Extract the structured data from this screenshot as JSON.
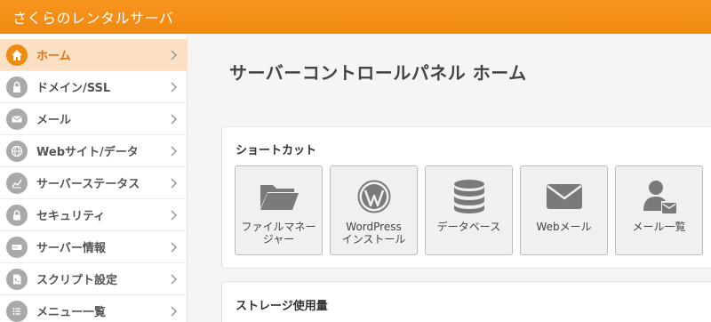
{
  "header": {
    "brand": "さくらのレンタルサーバ"
  },
  "sidebar": {
    "items": [
      {
        "label": "ホーム",
        "icon": "home-icon",
        "active": true
      },
      {
        "label": "ドメイン/SSL",
        "icon": "lock-icon",
        "active": false
      },
      {
        "label": "メール",
        "icon": "mail-icon",
        "active": false
      },
      {
        "label": "Webサイト/データ",
        "icon": "globe-icon",
        "active": false
      },
      {
        "label": "サーバーステータス",
        "icon": "chart-icon",
        "active": false
      },
      {
        "label": "セキュリティ",
        "icon": "padlock-icon",
        "active": false
      },
      {
        "label": "サーバー情報",
        "icon": "server-icon",
        "active": false
      },
      {
        "label": "スクリプト設定",
        "icon": "script-icon",
        "active": false
      },
      {
        "label": "メニュー一覧",
        "icon": "list-icon",
        "active": false
      }
    ]
  },
  "main": {
    "page_title": "サーバーコントロールパネル ホーム",
    "shortcuts": {
      "title": "ショートカット",
      "items": [
        {
          "line1": "ファイルマネー",
          "line2": "ジャー",
          "icon": "folder-icon"
        },
        {
          "line1": "WordPress",
          "line2": "インストール",
          "icon": "wordpress-icon"
        },
        {
          "line1": "データベース",
          "line2": "",
          "icon": "database-icon"
        },
        {
          "line1": "Webメール",
          "line2": "",
          "icon": "envelope-icon"
        },
        {
          "line1": "メール一覧",
          "line2": "",
          "icon": "user-mail-icon"
        }
      ]
    },
    "storage": {
      "title": "ストレージ使用量"
    }
  },
  "colors": {
    "brand_orange": "#f08a10",
    "active_bg": "#fbe0c4",
    "icon_gray": "#a9a9a9"
  }
}
